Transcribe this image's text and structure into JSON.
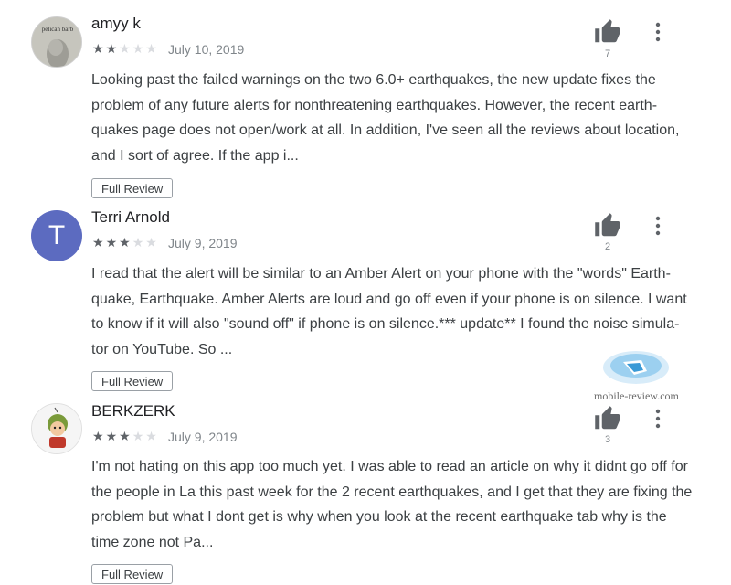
{
  "reviews": [
    {
      "author": "amyy k",
      "avatar_caption": "pelican barb",
      "rating": 2,
      "date": "July 10, 2019",
      "helpful_count": "7",
      "text": "Looking past the failed warnings on the two 6.0+ earthquakes, the new update fixes the problem of any future alerts for nonthreatening earthquakes. However, the recent earth-quakes page does not open/work at all. In addition, I've seen all the reviews about location, and I sort of agree. If the app i...",
      "full_review_label": "Full Review"
    },
    {
      "author": "Terri Arnold",
      "avatar_letter": "T",
      "rating": 3,
      "date": "July 9, 2019",
      "helpful_count": "2",
      "text": "I read that the alert will be similar to an Amber Alert on your phone with the \"words\" Earth-quake, Earthquake. Amber Alerts are loud and go off even if your phone is on silence. I want to know if it will also \"sound off\" if phone is on silence.*** update** I found the noise simula-tor on YouTube. So ...",
      "full_review_label": "Full Review"
    },
    {
      "author": "BERKZERK",
      "rating": 3,
      "date": "July 9, 2019",
      "helpful_count": "3",
      "text": "I'm not hating on this app too much yet. I was able to read an article on why it didnt go off for the people in La this past week for the 2 recent earthquakes, and I get that they are fixing the problem but what I dont get is why when you look at the recent earthquake tab why is the time zone not Pa...",
      "full_review_label": "Full Review"
    }
  ],
  "watermark": {
    "text": "mobile-review.com"
  },
  "colors": {
    "star_on": "#5f6368",
    "star_off": "#dadce0",
    "avatar_t": "#5c6bc0",
    "icon": "#5f6368"
  }
}
